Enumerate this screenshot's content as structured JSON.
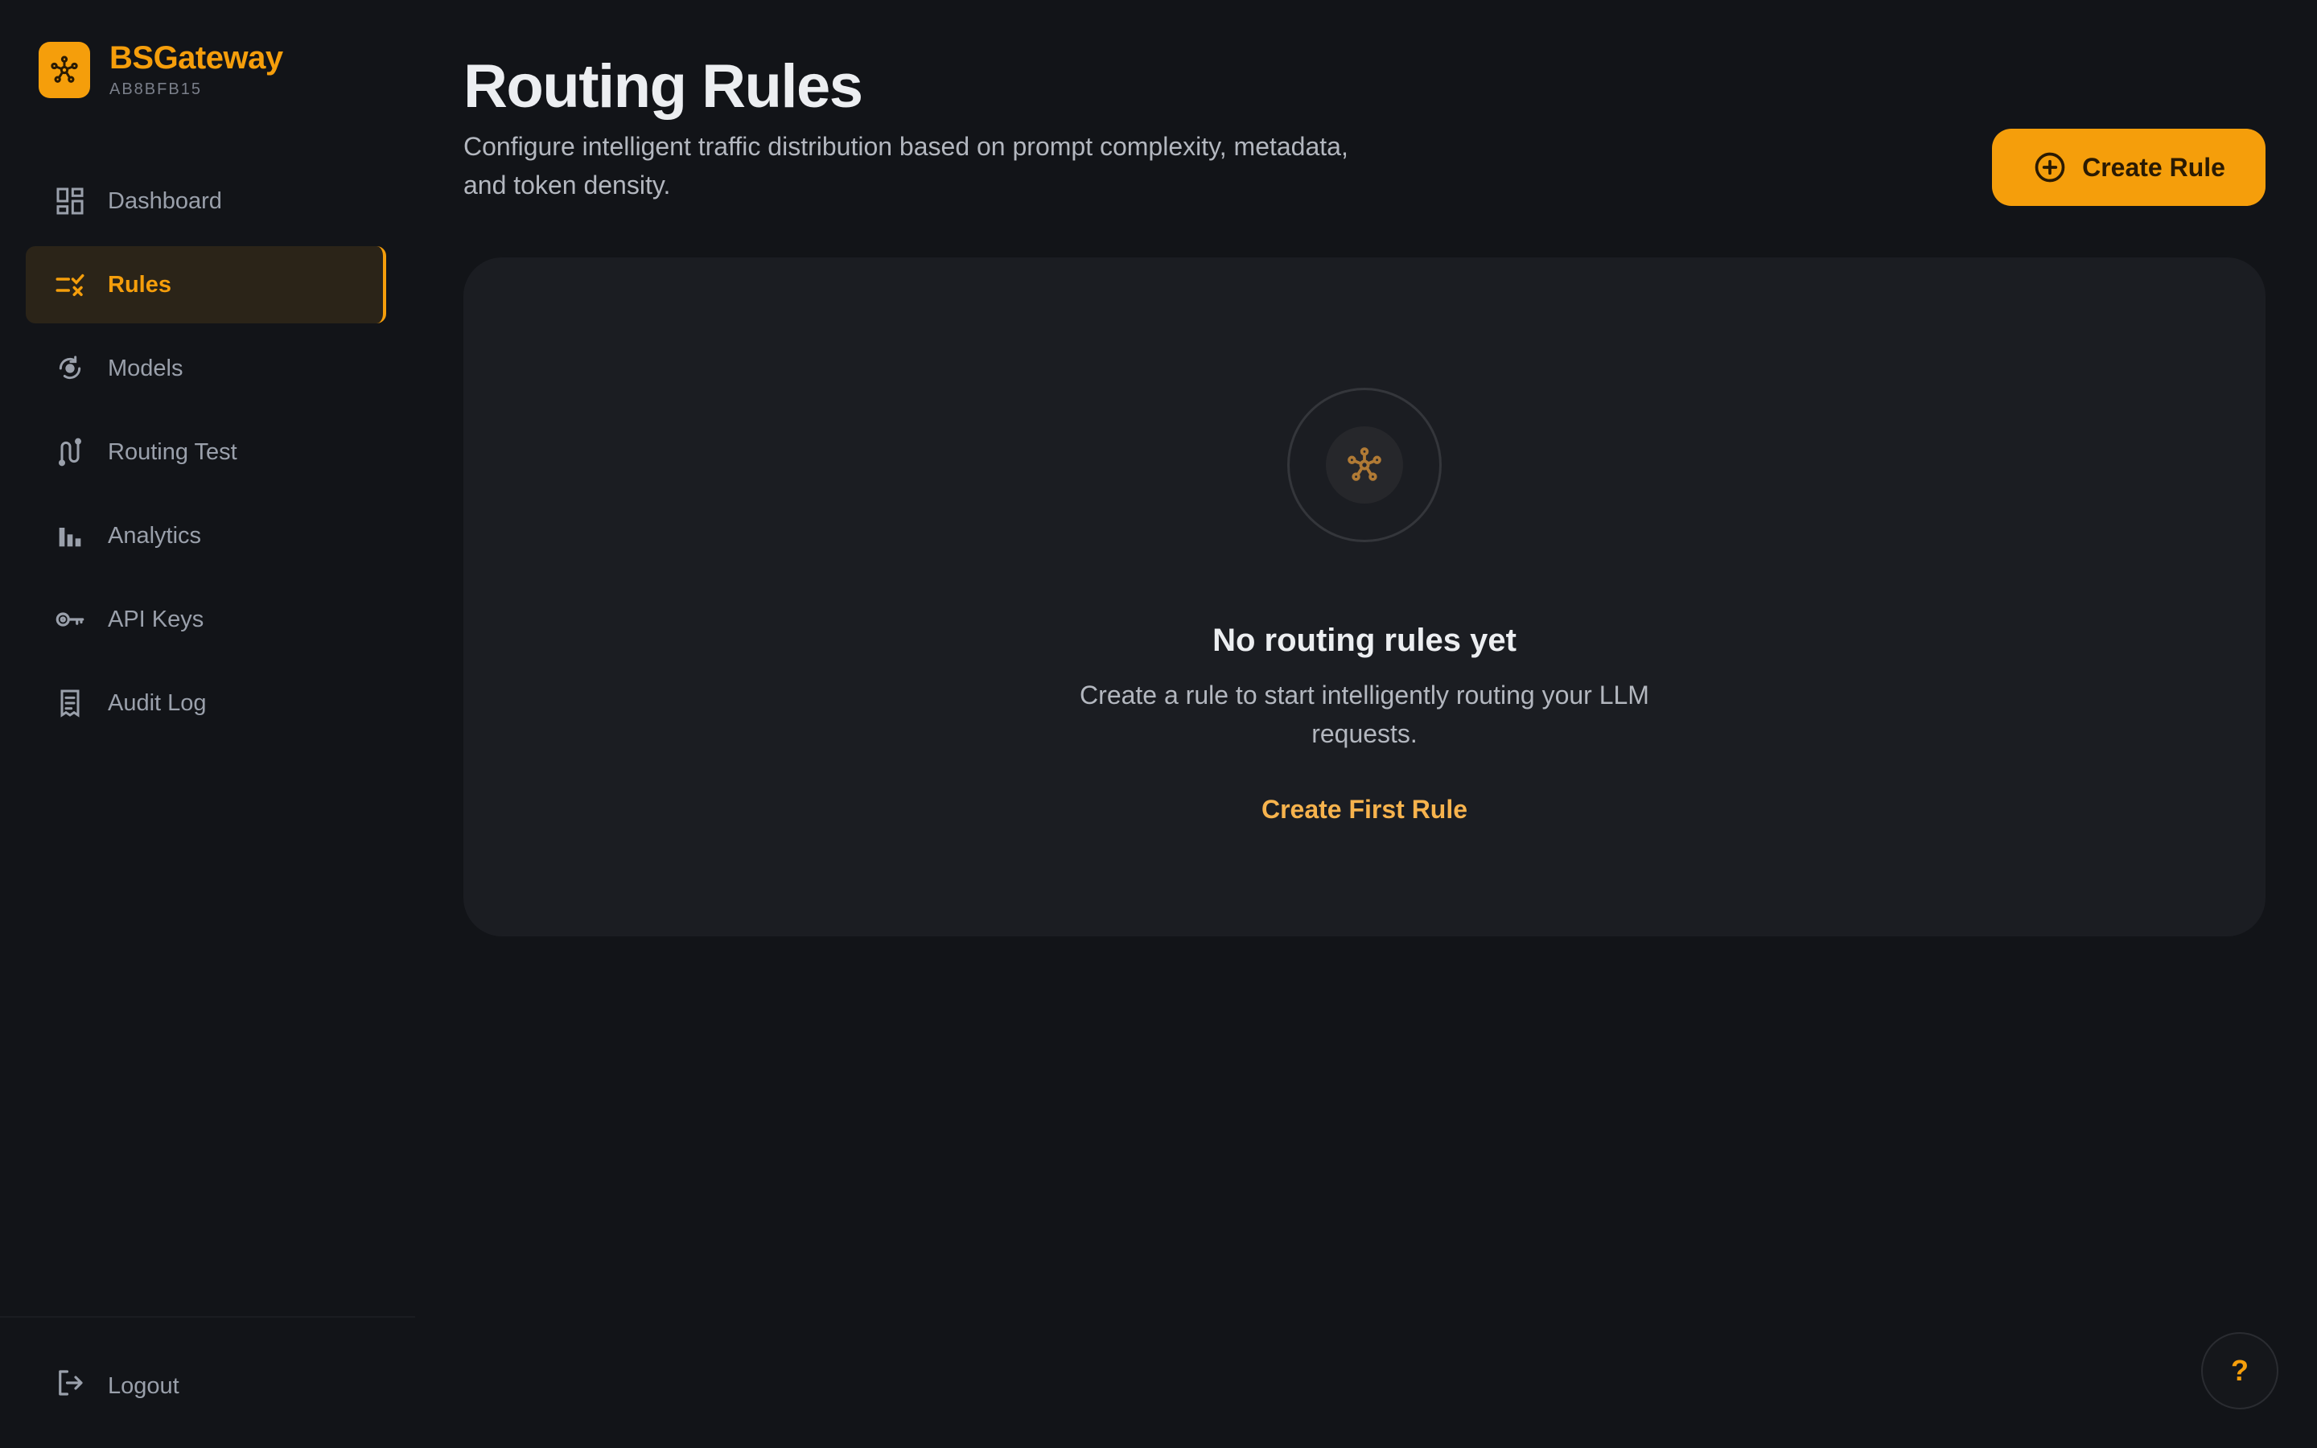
{
  "brand": {
    "name": "BSGateway",
    "id": "AB8BFB15",
    "logo_icon": "network-hub-icon"
  },
  "sidebar": {
    "items": [
      {
        "label": "Dashboard",
        "icon": "dashboard-icon",
        "active": false
      },
      {
        "label": "Rules",
        "icon": "rules-checklist-icon",
        "active": true
      },
      {
        "label": "Models",
        "icon": "models-icon",
        "active": false
      },
      {
        "label": "Routing Test",
        "icon": "route-icon",
        "active": false
      },
      {
        "label": "Analytics",
        "icon": "bar-chart-icon",
        "active": false
      },
      {
        "label": "API Keys",
        "icon": "key-icon",
        "active": false
      },
      {
        "label": "Audit Log",
        "icon": "receipt-icon",
        "active": false
      }
    ],
    "logout_label": "Logout"
  },
  "header": {
    "title": "Routing Rules",
    "subtitle": "Configure intelligent traffic distribution based on prompt complexity, metadata, and token density.",
    "create_button_label": "Create Rule"
  },
  "empty_state": {
    "icon": "network-hub-icon",
    "title": "No routing rules yet",
    "description": "Create a rule to start intelligently routing your LLM requests.",
    "action_label": "Create First Rule"
  },
  "help": {
    "label": "?"
  },
  "colors": {
    "accent": "#f59e0b",
    "background": "#121418",
    "card": "#1b1d22"
  }
}
